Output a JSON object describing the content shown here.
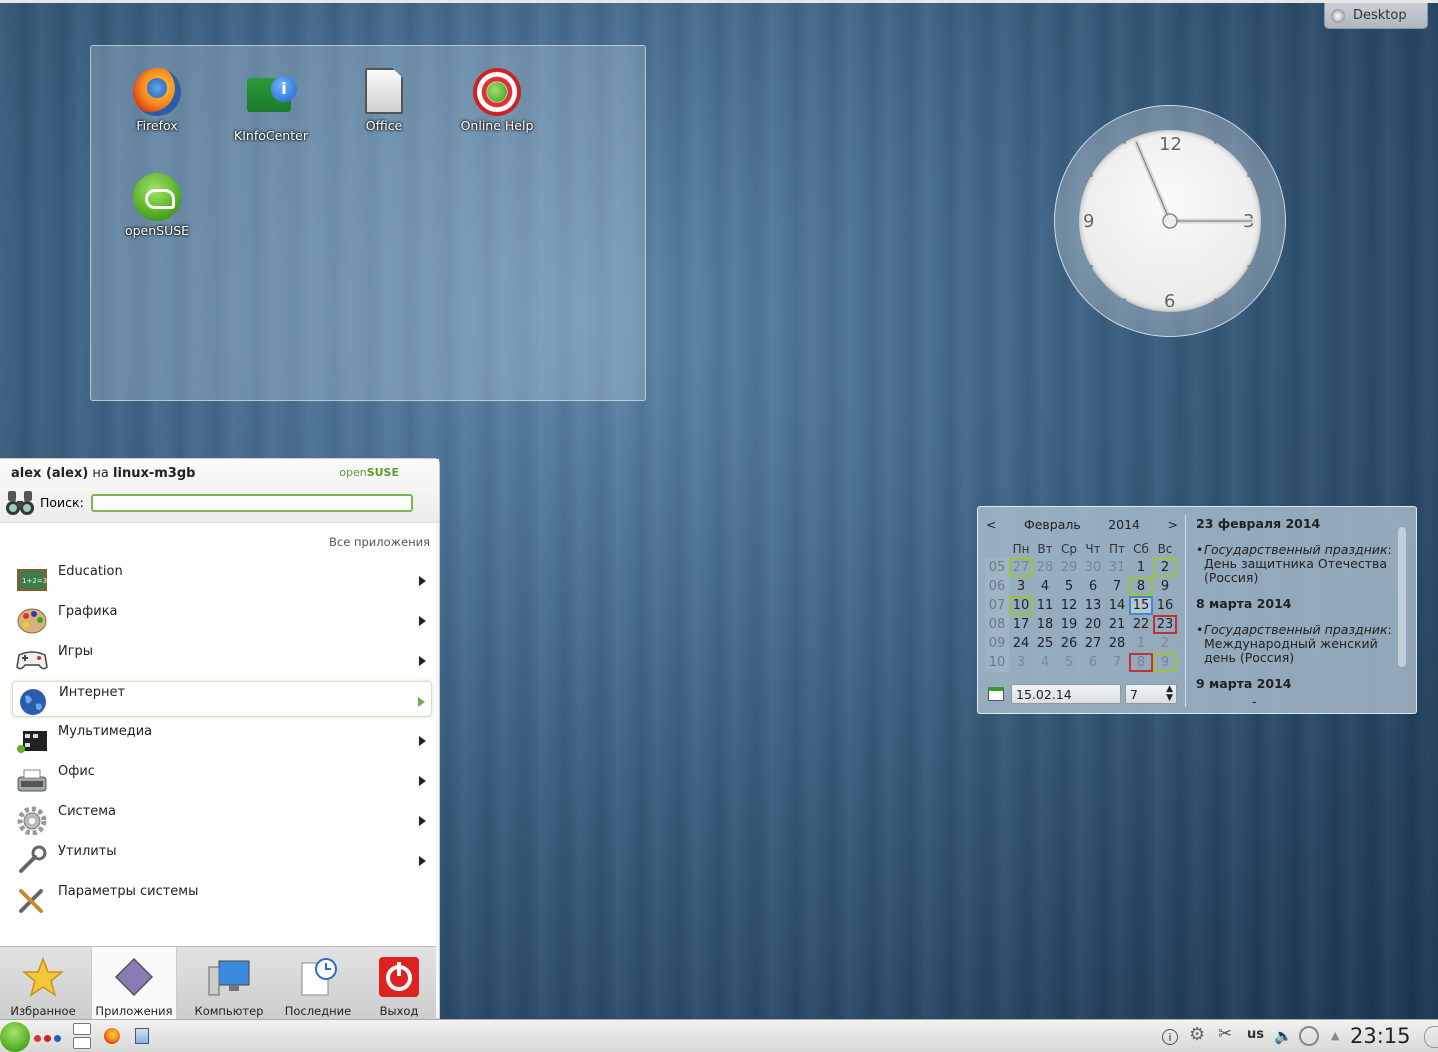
{
  "desktop": {
    "cashew_label": "Desktop",
    "icons": [
      {
        "label": "Firefox",
        "icon": "firefox-icon"
      },
      {
        "label": "KInfoCenter",
        "icon": "kinfocenter-icon"
      },
      {
        "label": "Office",
        "icon": "office-icon"
      },
      {
        "label": "Online Help",
        "icon": "help-icon"
      },
      {
        "label": "openSUSE",
        "icon": "opensuse-icon"
      }
    ]
  },
  "clock": {
    "numbers": [
      "12",
      "3",
      "6",
      "9"
    ],
    "hour": 23,
    "minute": 15
  },
  "calendar": {
    "prev": "<",
    "next": ">",
    "month": "Февраль",
    "year": "2014",
    "weekday_headers": [
      "Пн",
      "Вт",
      "Ср",
      "Чт",
      "Пт",
      "Сб",
      "Вс"
    ],
    "weeks": [
      {
        "num": "05",
        "days": [
          "27",
          "28",
          "29",
          "30",
          "31",
          "1",
          "2"
        ]
      },
      {
        "num": "06",
        "days": [
          "3",
          "4",
          "5",
          "6",
          "7",
          "8",
          "9"
        ]
      },
      {
        "num": "07",
        "days": [
          "10",
          "11",
          "12",
          "13",
          "14",
          "15",
          "16"
        ]
      },
      {
        "num": "08",
        "days": [
          "17",
          "18",
          "19",
          "20",
          "21",
          "22",
          "23"
        ]
      },
      {
        "num": "09",
        "days": [
          "24",
          "25",
          "26",
          "27",
          "28",
          "1",
          "2"
        ]
      },
      {
        "num": "10",
        "days": [
          "3",
          "4",
          "5",
          "6",
          "7",
          "8",
          "9"
        ]
      }
    ],
    "date_field": "15.02.14",
    "week_field": "7",
    "events": [
      {
        "date": "23 февраля 2014",
        "type": "Государственный праздник",
        "text": "День защитника Отечества (Россия)"
      },
      {
        "date": "8 марта 2014",
        "type": "Государственный праздник",
        "text": "Международный женский день (Россия)"
      },
      {
        "date": "9 марта 2014",
        "type": "",
        "text": "-"
      }
    ]
  },
  "kickoff": {
    "user": "alex (alex)",
    "on": "на",
    "host": "linux-m3gb",
    "brand_open": "open",
    "brand_suse": "SUSE",
    "search_label": "Поиск:",
    "search_value": "",
    "all_apps": "Все приложения",
    "items": [
      {
        "label": "Education",
        "icon": "education-icon",
        "submenu": true
      },
      {
        "label": "Графика",
        "icon": "graphics-palette-icon",
        "submenu": true
      },
      {
        "label": "Игры",
        "icon": "gamepad-icon",
        "submenu": true
      },
      {
        "label": "Интернет",
        "icon": "globe-icon",
        "submenu": true,
        "selected": true
      },
      {
        "label": "Мультимедиа",
        "icon": "multimedia-icon",
        "submenu": true
      },
      {
        "label": "Офис",
        "icon": "typewriter-icon",
        "submenu": true
      },
      {
        "label": "Система",
        "icon": "gear-icon",
        "submenu": true
      },
      {
        "label": "Утилиты",
        "icon": "wrench-icon",
        "submenu": true
      },
      {
        "label": "Параметры системы",
        "icon": "tools-icon",
        "submenu": false
      }
    ],
    "tabs": [
      {
        "label": "Избранное",
        "icon": "star-icon"
      },
      {
        "label": "Приложения",
        "icon": "applications-icon",
        "active": true
      },
      {
        "label": "Компьютер",
        "icon": "computer-icon"
      },
      {
        "label": "Последние",
        "icon": "recent-icon"
      },
      {
        "label": "Выход",
        "icon": "power-icon"
      }
    ]
  },
  "panel": {
    "keyboard_layout": "us",
    "time": "23:15"
  },
  "colors": {
    "accent_green": "#6db33f",
    "holiday_red": "#c03040",
    "today_blue": "#3d89d6"
  }
}
